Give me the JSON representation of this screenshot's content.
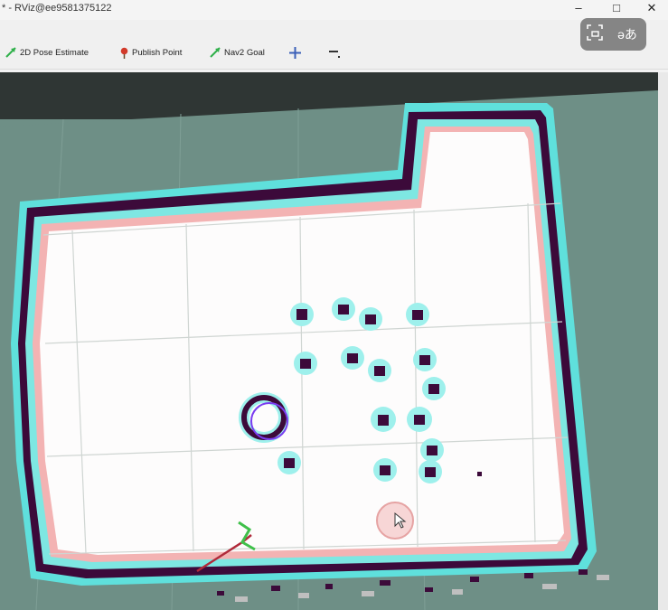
{
  "window": {
    "title": "* - RViz@ee9581375122",
    "controls": {
      "minimize": "–",
      "maximize": "□",
      "close": "✕"
    }
  },
  "toolbar": {
    "tools": [
      {
        "label": "2D Pose Estimate",
        "icon": "green-arrow-icon"
      },
      {
        "label": "Publish Point",
        "icon": "red-pin-icon"
      },
      {
        "label": "Nav2 Goal",
        "icon": "green-arrow-icon"
      },
      {
        "label": "",
        "icon": "move-crosshair-icon"
      },
      {
        "label": "",
        "icon": "minus-icon"
      }
    ]
  },
  "translate_overlay": {
    "icons": [
      "screen-capture-icon",
      "translate-icon"
    ],
    "translate_glyph": "əあ"
  },
  "map": {
    "grid_color": "#c8d0cc",
    "occupied_color": "#3c0a3a",
    "inflation_color": "#5fe0dc",
    "free_color": "#ffffff",
    "unknown_color": "#6e8f86"
  }
}
